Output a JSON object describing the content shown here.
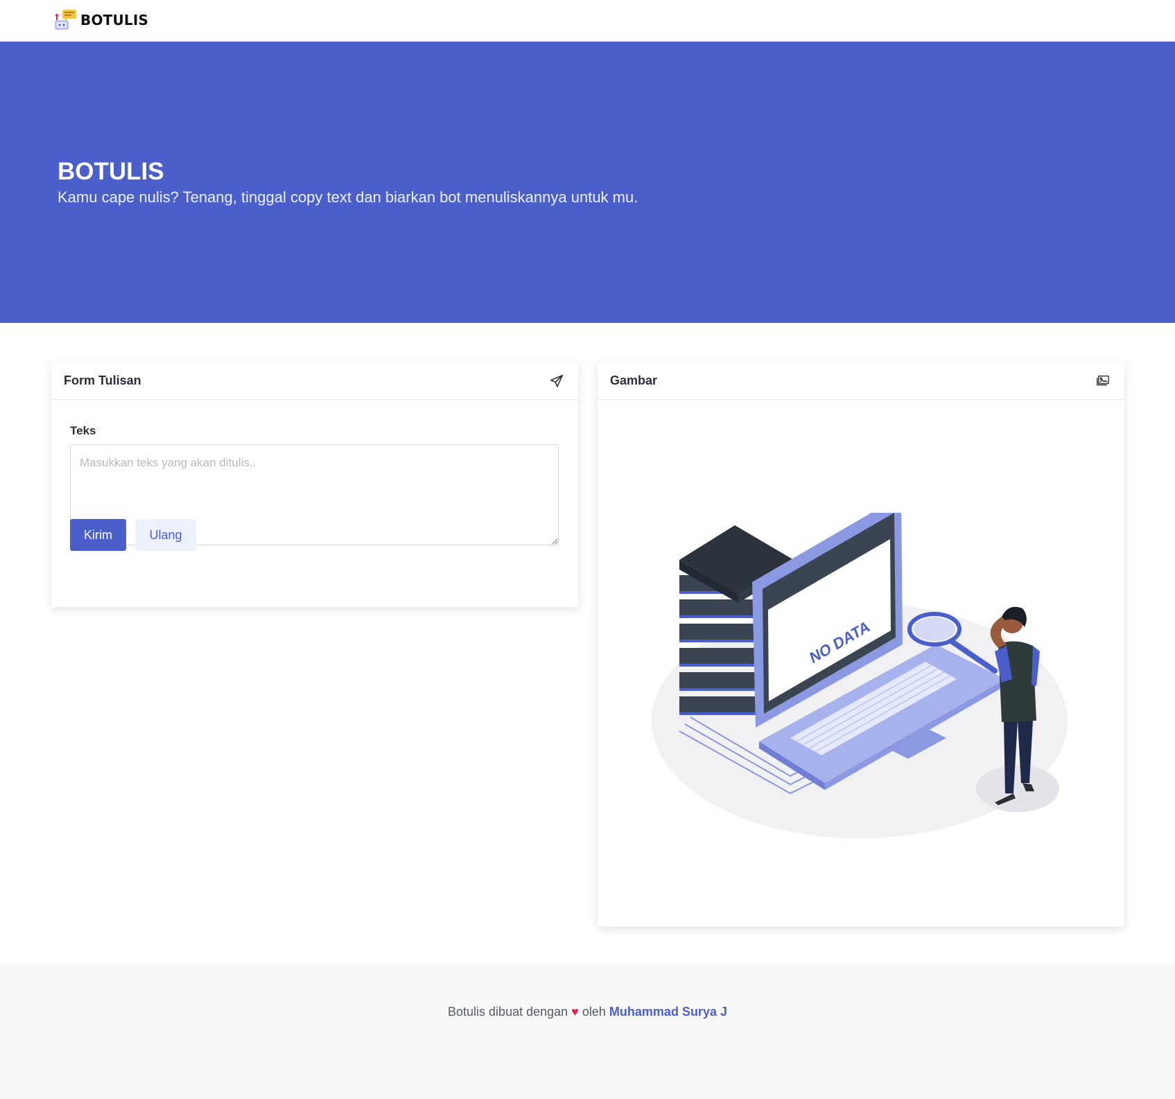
{
  "navbar": {
    "brand": "BOTULIS",
    "logo_icon": "robot-chat-logo-icon"
  },
  "hero": {
    "title": "BOTULIS",
    "subtitle": "Kamu cape nulis? Tenang, tinggal copy text dan biarkan bot menuliskannya untuk mu."
  },
  "form_card": {
    "title": "Form Tulisan",
    "icon": "send-icon",
    "label": "Teks",
    "textarea_placeholder": "Masukkan teks yang akan ditulis..",
    "textarea_value": "",
    "submit_label": "Kirim",
    "reset_label": "Ulang"
  },
  "image_card": {
    "title": "Gambar",
    "icon": "images-icon",
    "illustration_text": "NO DATA"
  },
  "footer": {
    "prefix": "Botulis dibuat dengan",
    "heart": "♥",
    "middle": "oleh",
    "author": "Muhammad Surya J"
  },
  "colors": {
    "primary": "#4a5fc9",
    "secondary_bg": "#eef0fb",
    "heart": "#e0245e",
    "footer_bg": "#f8f8f9"
  }
}
